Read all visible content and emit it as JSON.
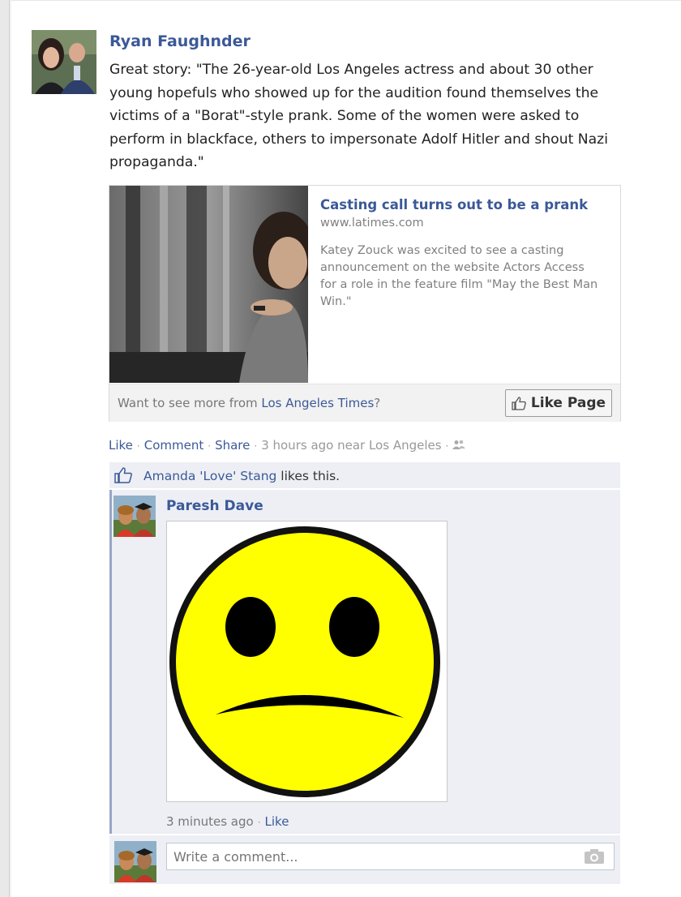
{
  "post": {
    "author": "Ryan Faughnder",
    "text": "Great story: \"The 26-year-old Los Angeles actress and about 30 other young hopefuls who showed up for the audition found themselves the victims of a \"Borat\"-style prank. Some of the women were asked to perform in blackface, others to impersonate Adolf Hitler and shout Nazi propaganda.\""
  },
  "share": {
    "title": "Casting call turns out to be a prank",
    "domain": "www.latimes.com",
    "description": "Katey Zouck was excited to see a casting announcement on the website Actors Access for a role in the feature film \"May the Best Man Win.\"",
    "footer_prefix": "Want to see more from ",
    "footer_link": "Los Angeles Times",
    "footer_suffix": "?",
    "like_page_label": "Like Page"
  },
  "actions": {
    "like": "Like",
    "comment": "Comment",
    "share": "Share",
    "time": "3 hours ago near Los Angeles",
    "separator": "·"
  },
  "likes": {
    "name": "Amanda 'Love' Stang",
    "suffix": " likes this."
  },
  "comment": {
    "author": "Paresh Dave",
    "time": "3 minutes ago",
    "like": "Like"
  },
  "reply": {
    "placeholder": "Write a comment..."
  },
  "colors": {
    "link": "#3b5998",
    "smiley_face": "#ffff00"
  },
  "icons": [
    "thumbs-up-icon",
    "friends-icon",
    "camera-icon"
  ]
}
